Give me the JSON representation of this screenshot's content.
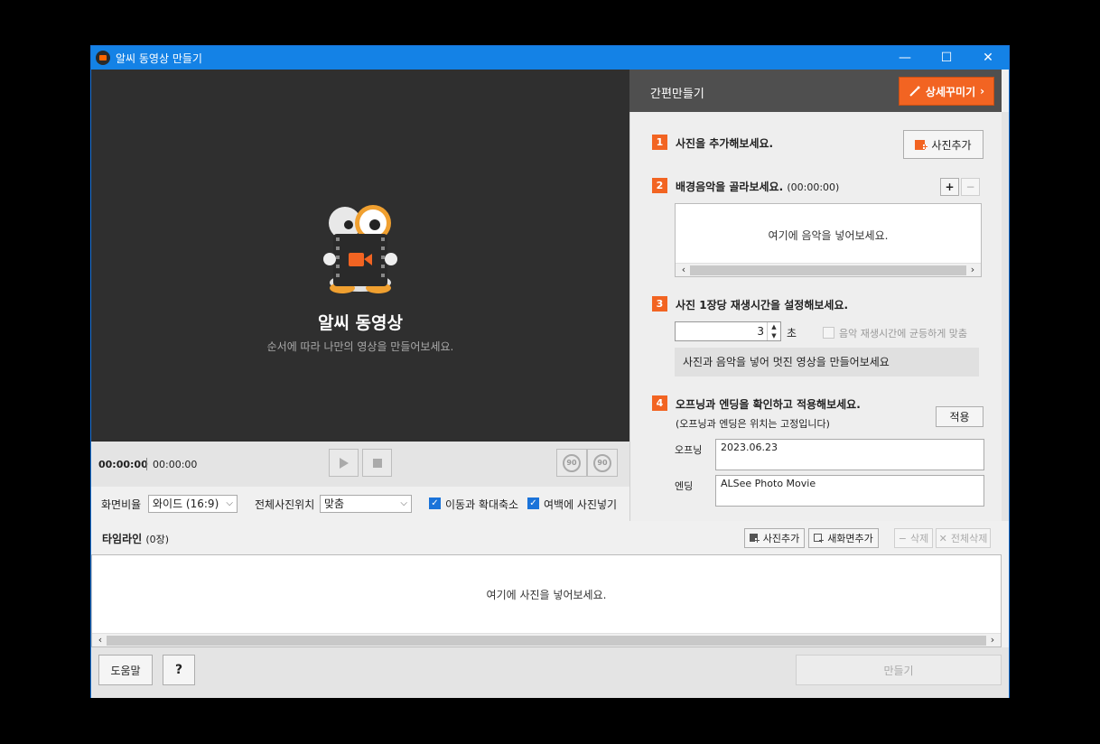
{
  "window": {
    "title": "알씨 동영상 만들기",
    "minimize": "—",
    "maximize": "☐",
    "close": "✕"
  },
  "preview": {
    "title": "알씨 동영상",
    "subtitle": "순서에 따라 나만의 영상을 만들어보세요.",
    "time_current": "00:00:00",
    "time_total": "00:00:00",
    "rotate_left_label": "90",
    "rotate_right_label": "90"
  },
  "options": {
    "aspect_label": "화면비율",
    "aspect_value": "와이드 (16:9)",
    "position_label": "전체사진위치",
    "position_value": "맞춤",
    "move_zoom_label": "이동과 확대축소",
    "move_zoom_checked": true,
    "fill_margin_label": "여백에 사진넣기",
    "fill_margin_checked": true
  },
  "panel": {
    "title": "간편만들기",
    "detail_button": "상세꾸미기",
    "step1": {
      "num": "1",
      "text": "사진을 추가해보세요.",
      "button": "사진추가"
    },
    "step2": {
      "num": "2",
      "text": "배경음악을 골라보세요.",
      "duration": "(00:00:00)",
      "add": "+",
      "remove": "−",
      "placeholder": "여기에 음악을 넣어보세요."
    },
    "step3": {
      "num": "3",
      "text": "사진 1장당 재생시간을 설정해보세요.",
      "seconds_value": "3",
      "seconds_unit": "초",
      "fit_music_label": "음악 재생시간에 균등하게 맞춤",
      "fit_music_checked": false,
      "info": "사진과 음악을 넣어 멋진 영상을 만들어보세요"
    },
    "step4": {
      "num": "4",
      "text": "오프닝과 엔딩을 확인하고 적용해보세요.",
      "note": "(오프닝과 엔딩은 위치는 고정입니다)",
      "apply_button": "적용",
      "opening_label": "오프닝",
      "opening_value": "2023.06.23",
      "ending_label": "엔딩",
      "ending_value": "ALSee Photo Movie"
    }
  },
  "timeline": {
    "title": "타임라인",
    "count": "(0장)",
    "add_photo": "사진추가",
    "add_screen": "새화면추가",
    "delete": "삭제",
    "delete_all": "전체삭제",
    "placeholder": "여기에 사진을 넣어보세요."
  },
  "footer": {
    "help": "도움말",
    "question": "?",
    "make": "만들기"
  },
  "colors": {
    "accent": "#f26422",
    "titlebar": "#1482e6",
    "preview_bg": "#2f2f2f"
  }
}
